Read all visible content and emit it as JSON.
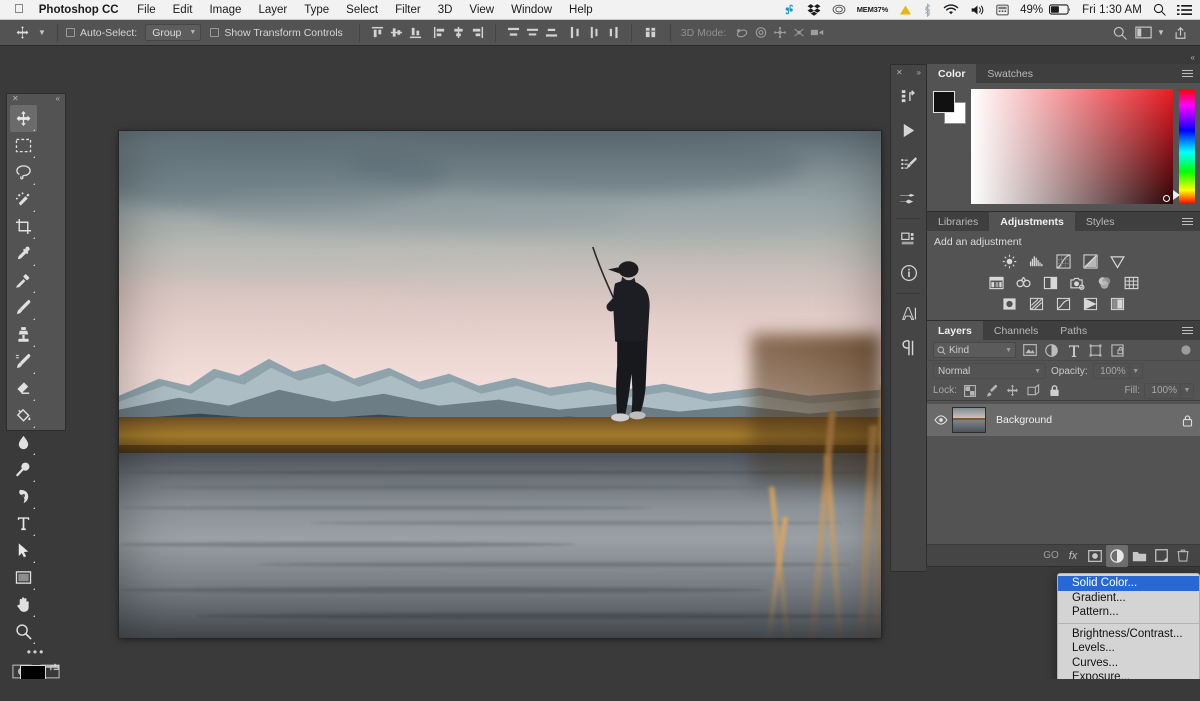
{
  "menubar": {
    "apple_icon": "apple-logo",
    "app_name": "Photoshop CC",
    "items": [
      "File",
      "Edit",
      "Image",
      "Layer",
      "Type",
      "Select",
      "Filter",
      "3D",
      "View",
      "Window",
      "Help"
    ],
    "status": {
      "slack_icon": "slack-icon",
      "dropbox_icon": "dropbox-icon",
      "creative_cloud_icon": "creative-cloud-icon",
      "mem_label": "MEM",
      "mem_value": "37%",
      "warning_icon": "warning-triangle-icon",
      "bluetooth_icon": "bluetooth-icon",
      "wifi_icon": "wifi-icon",
      "volume_icon": "volume-icon",
      "calculator_icon": "calculator-icon",
      "battery_percent": "49%",
      "battery_icon": "battery-icon",
      "clock": "Fri 1:30 AM",
      "search_icon": "spotlight-search-icon",
      "notifications_icon": "notification-center-icon"
    }
  },
  "optionsbar": {
    "tool_icon": "move-tool-icon",
    "auto_select_label": "Auto-Select:",
    "auto_select_value": "Group",
    "show_transform_label": "Show Transform Controls",
    "align_icons": [
      "align-top-edges-icon",
      "align-vertical-centers-icon",
      "align-bottom-edges-icon",
      "align-left-edges-icon",
      "align-horizontal-centers-icon",
      "align-right-edges-icon"
    ],
    "distribute_icons": [
      "distribute-top-edges-icon",
      "distribute-vertical-centers-icon",
      "distribute-bottom-edges-icon",
      "distribute-left-edges-icon",
      "distribute-horizontal-centers-icon",
      "distribute-right-edges-icon"
    ],
    "auto_align_icon": "auto-align-layers-icon",
    "mode_3d_label": "3D Mode:",
    "mode_3d_icons": [
      "rotate-3d-icon",
      "roll-3d-icon",
      "pan-3d-icon",
      "slide-3d-icon",
      "scale-3d-icon"
    ],
    "right_icons": [
      "search-icon",
      "workspace-icon",
      "share-icon"
    ]
  },
  "toolbox": {
    "close_icon": "close-icon",
    "collapse_icon": "collapse-icon",
    "tools": [
      {
        "name": "move-tool",
        "selected": true
      },
      {
        "name": "rectangular-marquee-tool",
        "selected": false
      },
      {
        "name": "lasso-tool",
        "selected": false
      },
      {
        "name": "quick-selection-tool",
        "selected": false
      },
      {
        "name": "crop-tool",
        "selected": false
      },
      {
        "name": "eyedropper-tool",
        "selected": false
      },
      {
        "name": "spot-healing-brush-tool",
        "selected": false
      },
      {
        "name": "brush-tool",
        "selected": false
      },
      {
        "name": "clone-stamp-tool",
        "selected": false
      },
      {
        "name": "history-brush-tool",
        "selected": false
      },
      {
        "name": "eraser-tool",
        "selected": false
      },
      {
        "name": "paint-bucket-tool",
        "selected": false
      },
      {
        "name": "blur-tool",
        "selected": false
      },
      {
        "name": "dodge-tool",
        "selected": false
      },
      {
        "name": "pen-tool",
        "selected": false
      },
      {
        "name": "horizontal-type-tool",
        "selected": false
      },
      {
        "name": "path-selection-tool",
        "selected": false
      },
      {
        "name": "rectangle-tool",
        "selected": false
      },
      {
        "name": "hand-tool",
        "selected": false
      },
      {
        "name": "zoom-tool",
        "selected": false
      }
    ],
    "more_tools_icon": "edit-toolbar-ellipsis-icon",
    "foreground_color": "#000000",
    "background_color": "#ffffff",
    "swap_colors_icon": "swap-colors-icon",
    "default_colors_icon": "default-colors-icon",
    "quick_mask_icon": "quick-mask-mode-icon",
    "screen_mode_icon": "screen-mode-icon"
  },
  "dock_icons": [
    {
      "name": "history-panel-icon"
    },
    {
      "name": "actions-panel-icon"
    },
    {
      "name": "brush-presets-panel-icon"
    },
    {
      "name": "tool-presets-panel-icon"
    },
    {
      "name": "properties-panel-icon"
    },
    {
      "name": "info-panel-icon"
    },
    {
      "name": "character-panel-icon"
    },
    {
      "name": "paragraph-panel-icon"
    }
  ],
  "color_panel": {
    "tabs": [
      {
        "label": "Color",
        "active": true
      },
      {
        "label": "Swatches",
        "active": false
      }
    ],
    "foreground_color": "#111111",
    "background_color": "#ffffff",
    "active_hue": "#ec1c24"
  },
  "adjustments_panel": {
    "tabs": [
      {
        "label": "Libraries",
        "active": false
      },
      {
        "label": "Adjustments",
        "active": true
      },
      {
        "label": "Styles",
        "active": false
      }
    ],
    "heading": "Add an adjustment",
    "rows": [
      [
        "brightness-contrast-icon",
        "levels-icon",
        "curves-icon",
        "exposure-icon",
        "vibrance-icon"
      ],
      [
        "hue-saturation-icon",
        "color-balance-icon",
        "black-white-icon",
        "photo-filter-icon",
        "channel-mixer-icon",
        "color-lookup-icon"
      ],
      [
        "invert-icon",
        "posterize-icon",
        "threshold-icon",
        "selective-color-icon",
        "gradient-map-icon"
      ]
    ]
  },
  "layers_panel": {
    "tabs": [
      {
        "label": "Layers",
        "active": true
      },
      {
        "label": "Channels",
        "active": false
      },
      {
        "label": "Paths",
        "active": false
      }
    ],
    "filter_label": "Kind",
    "filter_icons": [
      "pixel-layers-filter-icon",
      "adjustment-layers-filter-icon",
      "type-layers-filter-icon",
      "shape-layers-filter-icon",
      "smart-object-filter-icon"
    ],
    "filter_toggle_icon": "filter-toggle-icon",
    "blend_mode": "Normal",
    "opacity_label": "Opacity:",
    "opacity_value": "100%",
    "lock_label": "Lock:",
    "lock_icons": [
      "lock-transparent-pixels-icon",
      "lock-image-pixels-icon",
      "lock-position-icon",
      "lock-artboard-nesting-icon",
      "lock-all-icon"
    ],
    "fill_label": "Fill:",
    "fill_value": "100%",
    "layers": [
      {
        "name": "Background",
        "visible": true,
        "locked": true,
        "visibility_icon": "eye-icon",
        "lock_icon": "lock-icon"
      }
    ],
    "bottom_icons": [
      {
        "name": "link-layers-icon",
        "label": "GO",
        "active": false
      },
      {
        "name": "layer-style-fx-icon",
        "label": "fx",
        "active": false
      },
      {
        "name": "add-layer-mask-icon",
        "label": "",
        "active": false
      },
      {
        "name": "new-fill-adjustment-layer-icon",
        "label": "",
        "active": true
      },
      {
        "name": "new-group-icon",
        "label": "",
        "active": false
      },
      {
        "name": "new-layer-icon",
        "label": "",
        "active": false
      },
      {
        "name": "delete-layer-icon",
        "label": "",
        "active": false
      }
    ]
  },
  "context_menu": {
    "items": [
      {
        "label": "Solid Color...",
        "selected": true
      },
      {
        "label": "Gradient...",
        "selected": false
      },
      {
        "label": "Pattern...",
        "selected": false
      },
      {
        "separator": true
      },
      {
        "label": "Brightness/Contrast...",
        "selected": false
      },
      {
        "label": "Levels...",
        "selected": false
      },
      {
        "label": "Curves...",
        "selected": false
      },
      {
        "label": "Exposure...",
        "selected": false
      }
    ],
    "scroll_arrow": "▼"
  },
  "document": {
    "name": "fly-fishing-landscape-photo",
    "description": "Photograph of a fly fisherman casting beside a river with snow-capped mountains at dusk"
  }
}
